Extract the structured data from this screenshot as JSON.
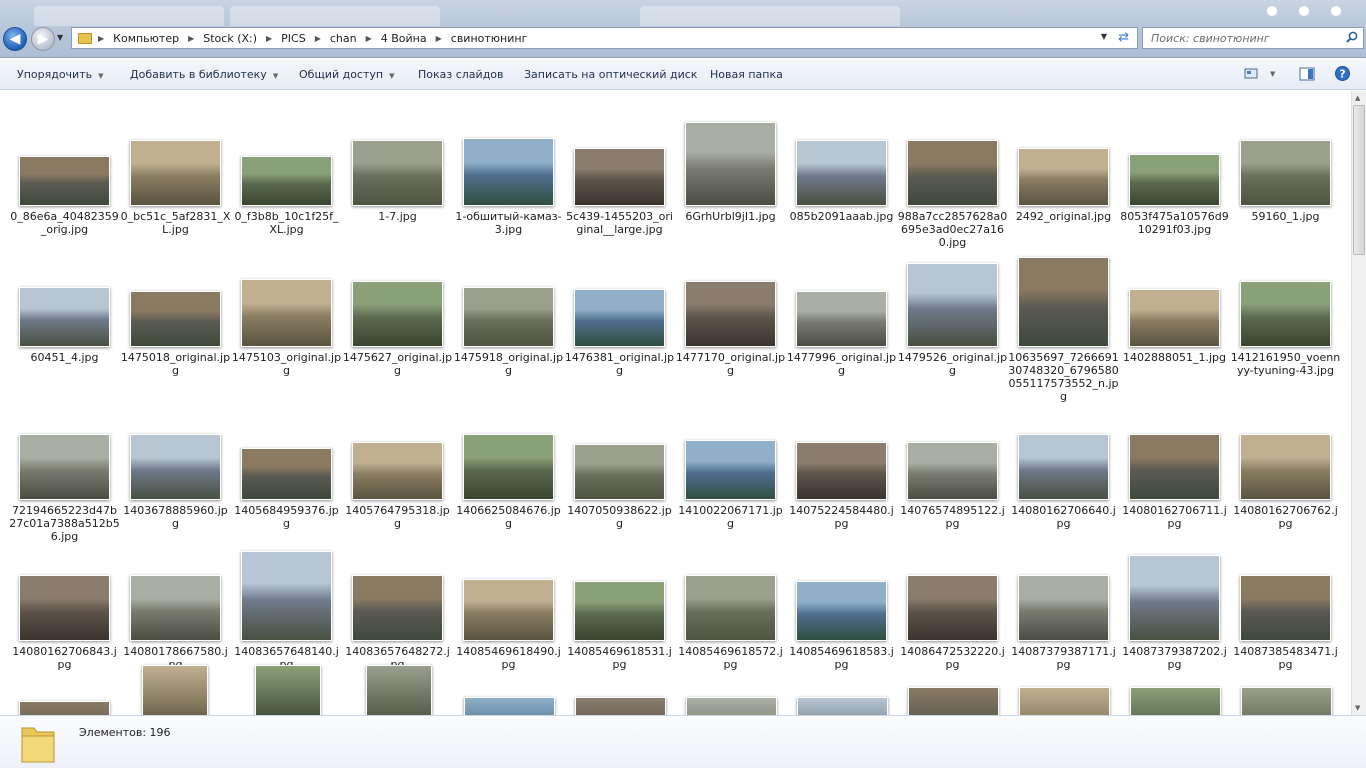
{
  "window": {
    "breadcrumb": [
      "Компьютер",
      "Stock (X:)",
      "PICS",
      "chan",
      "4 Война",
      "свинотюнинг"
    ],
    "search_placeholder": "Поиск: свинотюнинг"
  },
  "toolbar": {
    "organize": "Упорядочить",
    "add_library": "Добавить в библиотеку",
    "share": "Общий доступ",
    "slideshow": "Показ слайдов",
    "burn": "Записать на оптический диск",
    "new_folder": "Новая папка"
  },
  "colors": {
    "accent": "#3a7bd5",
    "toolbar_text": "#1e3050"
  },
  "files": [
    [
      "0_86e6a_40482359_orig.jpg",
      "0_bc51c_5af2831_XL.jpg",
      "0_f3b8b_10c1f25f_XL.jpg",
      "1-7.jpg",
      "1-обшитый-камаз-3.jpg",
      "5c439-1455203_original__large.jpg",
      "6GrhUrbl9jI1.jpg",
      "085b2091aaab.jpg",
      "988a7cc2857628a0695e3ad0ec27a160.jpg",
      "2492_original.jpg",
      "8053f475a10576d910291f03.jpg",
      "59160_1.jpg"
    ],
    [
      "60451_4.jpg",
      "1475018_original.jpg",
      "1475103_original.jpg",
      "1475627_original.jpg",
      "1475918_original.jpg",
      "1476381_original.jpg",
      "1477170_original.jpg",
      "1477996_original.jpg",
      "1479526_original.jpg",
      "10635697_726669130748320_6796580055117573552_n.jpg",
      "1402888051_1.jpg",
      "1412161950_voennyy-tyuning-43.jpg"
    ],
    [
      "72194665223d47b27c01a7388a512b56.jpg",
      "1403678885960.jpg",
      "1405684959376.jpg",
      "1405764795318.jpg",
      "1406625084676.jpg",
      "1407050938622.jpg",
      "1410022067171.jpg",
      "1407522458448​0.jpg",
      "1407657489512​2.jpg",
      "14080162706640.jpg",
      "14080162706711.jpg",
      "14080162706762.jpg"
    ],
    [
      "14080162706843.jpg",
      "14080178667580.jpg",
      "14083657648140.jpg",
      "14083657648272.jpg",
      "14085469618490.jpg",
      "14085469618531.jpg",
      "14085469618572.jpg",
      "14085469618583.jpg",
      "14086472532220.jpg",
      "14087379387171.jpg",
      "14087379387202.jpg",
      "14087385483471.jpg"
    ]
  ],
  "status": {
    "count": "Элементов: 196"
  }
}
